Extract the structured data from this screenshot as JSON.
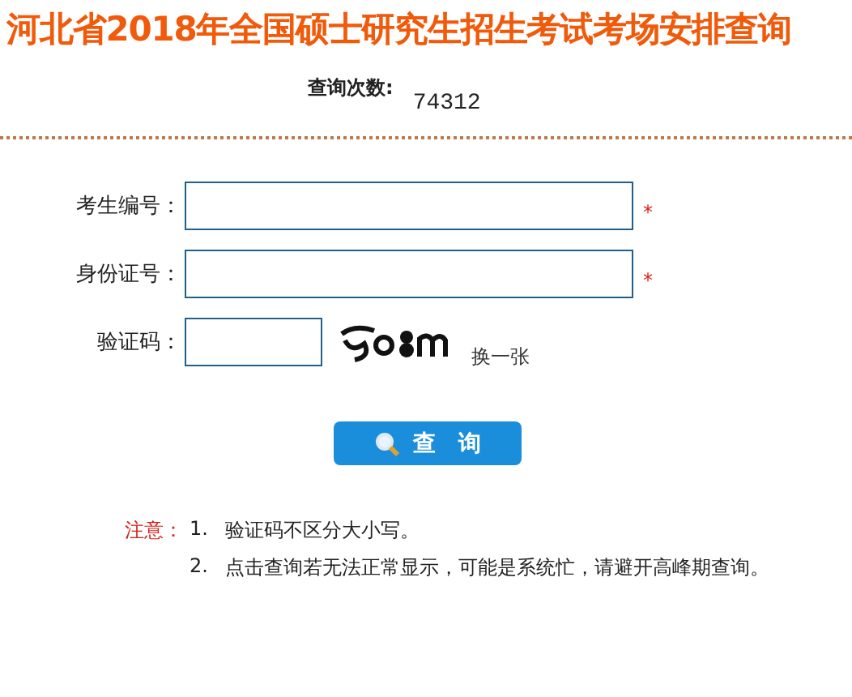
{
  "title": "河北省2018年全国硕士研究生招生考试考场安排查询",
  "counter": {
    "label": "查询次数:",
    "value": "74312"
  },
  "fields": [
    {
      "kind": "text",
      "label": "考生编号：",
      "required_mark": "*"
    },
    {
      "kind": "text",
      "label": "身份证号：",
      "required_mark": "*"
    },
    {
      "kind": "captcha",
      "label": "验证码：",
      "refresh_link": "换一张"
    }
  ],
  "submit_button": {
    "label": "查　询"
  },
  "notes": {
    "label": "注意：",
    "items": [
      {
        "number": "1.",
        "text": "验证码不区分大小写。"
      },
      {
        "number": "2.",
        "text": "点击查询若无法正常显示，可能是系统忙，请避开高峰期查询。"
      }
    ]
  }
}
